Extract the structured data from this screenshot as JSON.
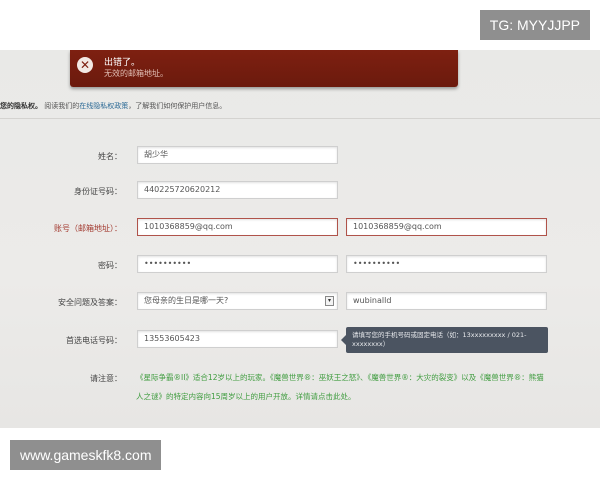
{
  "overlay": {
    "top_right": "TG: MYYJJPP",
    "bottom_left": "www.gameskfk8.com"
  },
  "error": {
    "icon": "close-icon",
    "title": "出错了。",
    "message": "无效的邮箱地址。"
  },
  "privacy": {
    "prefix_bold": "您的隐私权。",
    "before_link": "阅读我们的",
    "link": "在线隐私权政策",
    "after_link": "，了解我们如何保护用户信息。"
  },
  "form": {
    "name": {
      "label": "姓名：",
      "value": "胡少华"
    },
    "id_number": {
      "label": "身份证号码：",
      "value": "440225720620212"
    },
    "account": {
      "label": "账号（邮箱地址）：",
      "value": "1010368859@qq.com",
      "confirm_value": "1010368859@qq.com"
    },
    "password": {
      "label": "密码：",
      "value": "••••••••••",
      "confirm_value": "••••••••••"
    },
    "security": {
      "label": "安全问题及答案：",
      "question": "您母亲的生日是哪一天?",
      "answer": "wubinalld"
    },
    "phone": {
      "label": "首选电话号码：",
      "value": "13553605423",
      "tooltip": "请填写您的手机号码或固定电话（如：13xxxxxxxxx / 021-xxxxxxxx）"
    },
    "notice": {
      "label": "请注意：",
      "text": "《星际争霸®II》适合12岁以上的玩家。《魔兽世界®：巫妖王之怒》、《魔兽世界®：大灾的裂变》以及《魔兽世界®：熊猫人之谜》的特定内容向15周岁以上的用户开放。详情请点击此处。"
    }
  },
  "colors": {
    "error_banner": "#7e2011",
    "error_label": "#a33a30",
    "notice_green": "#3f9c3f",
    "link_blue": "#2c6a96",
    "tooltip_bg": "#4b5461"
  }
}
